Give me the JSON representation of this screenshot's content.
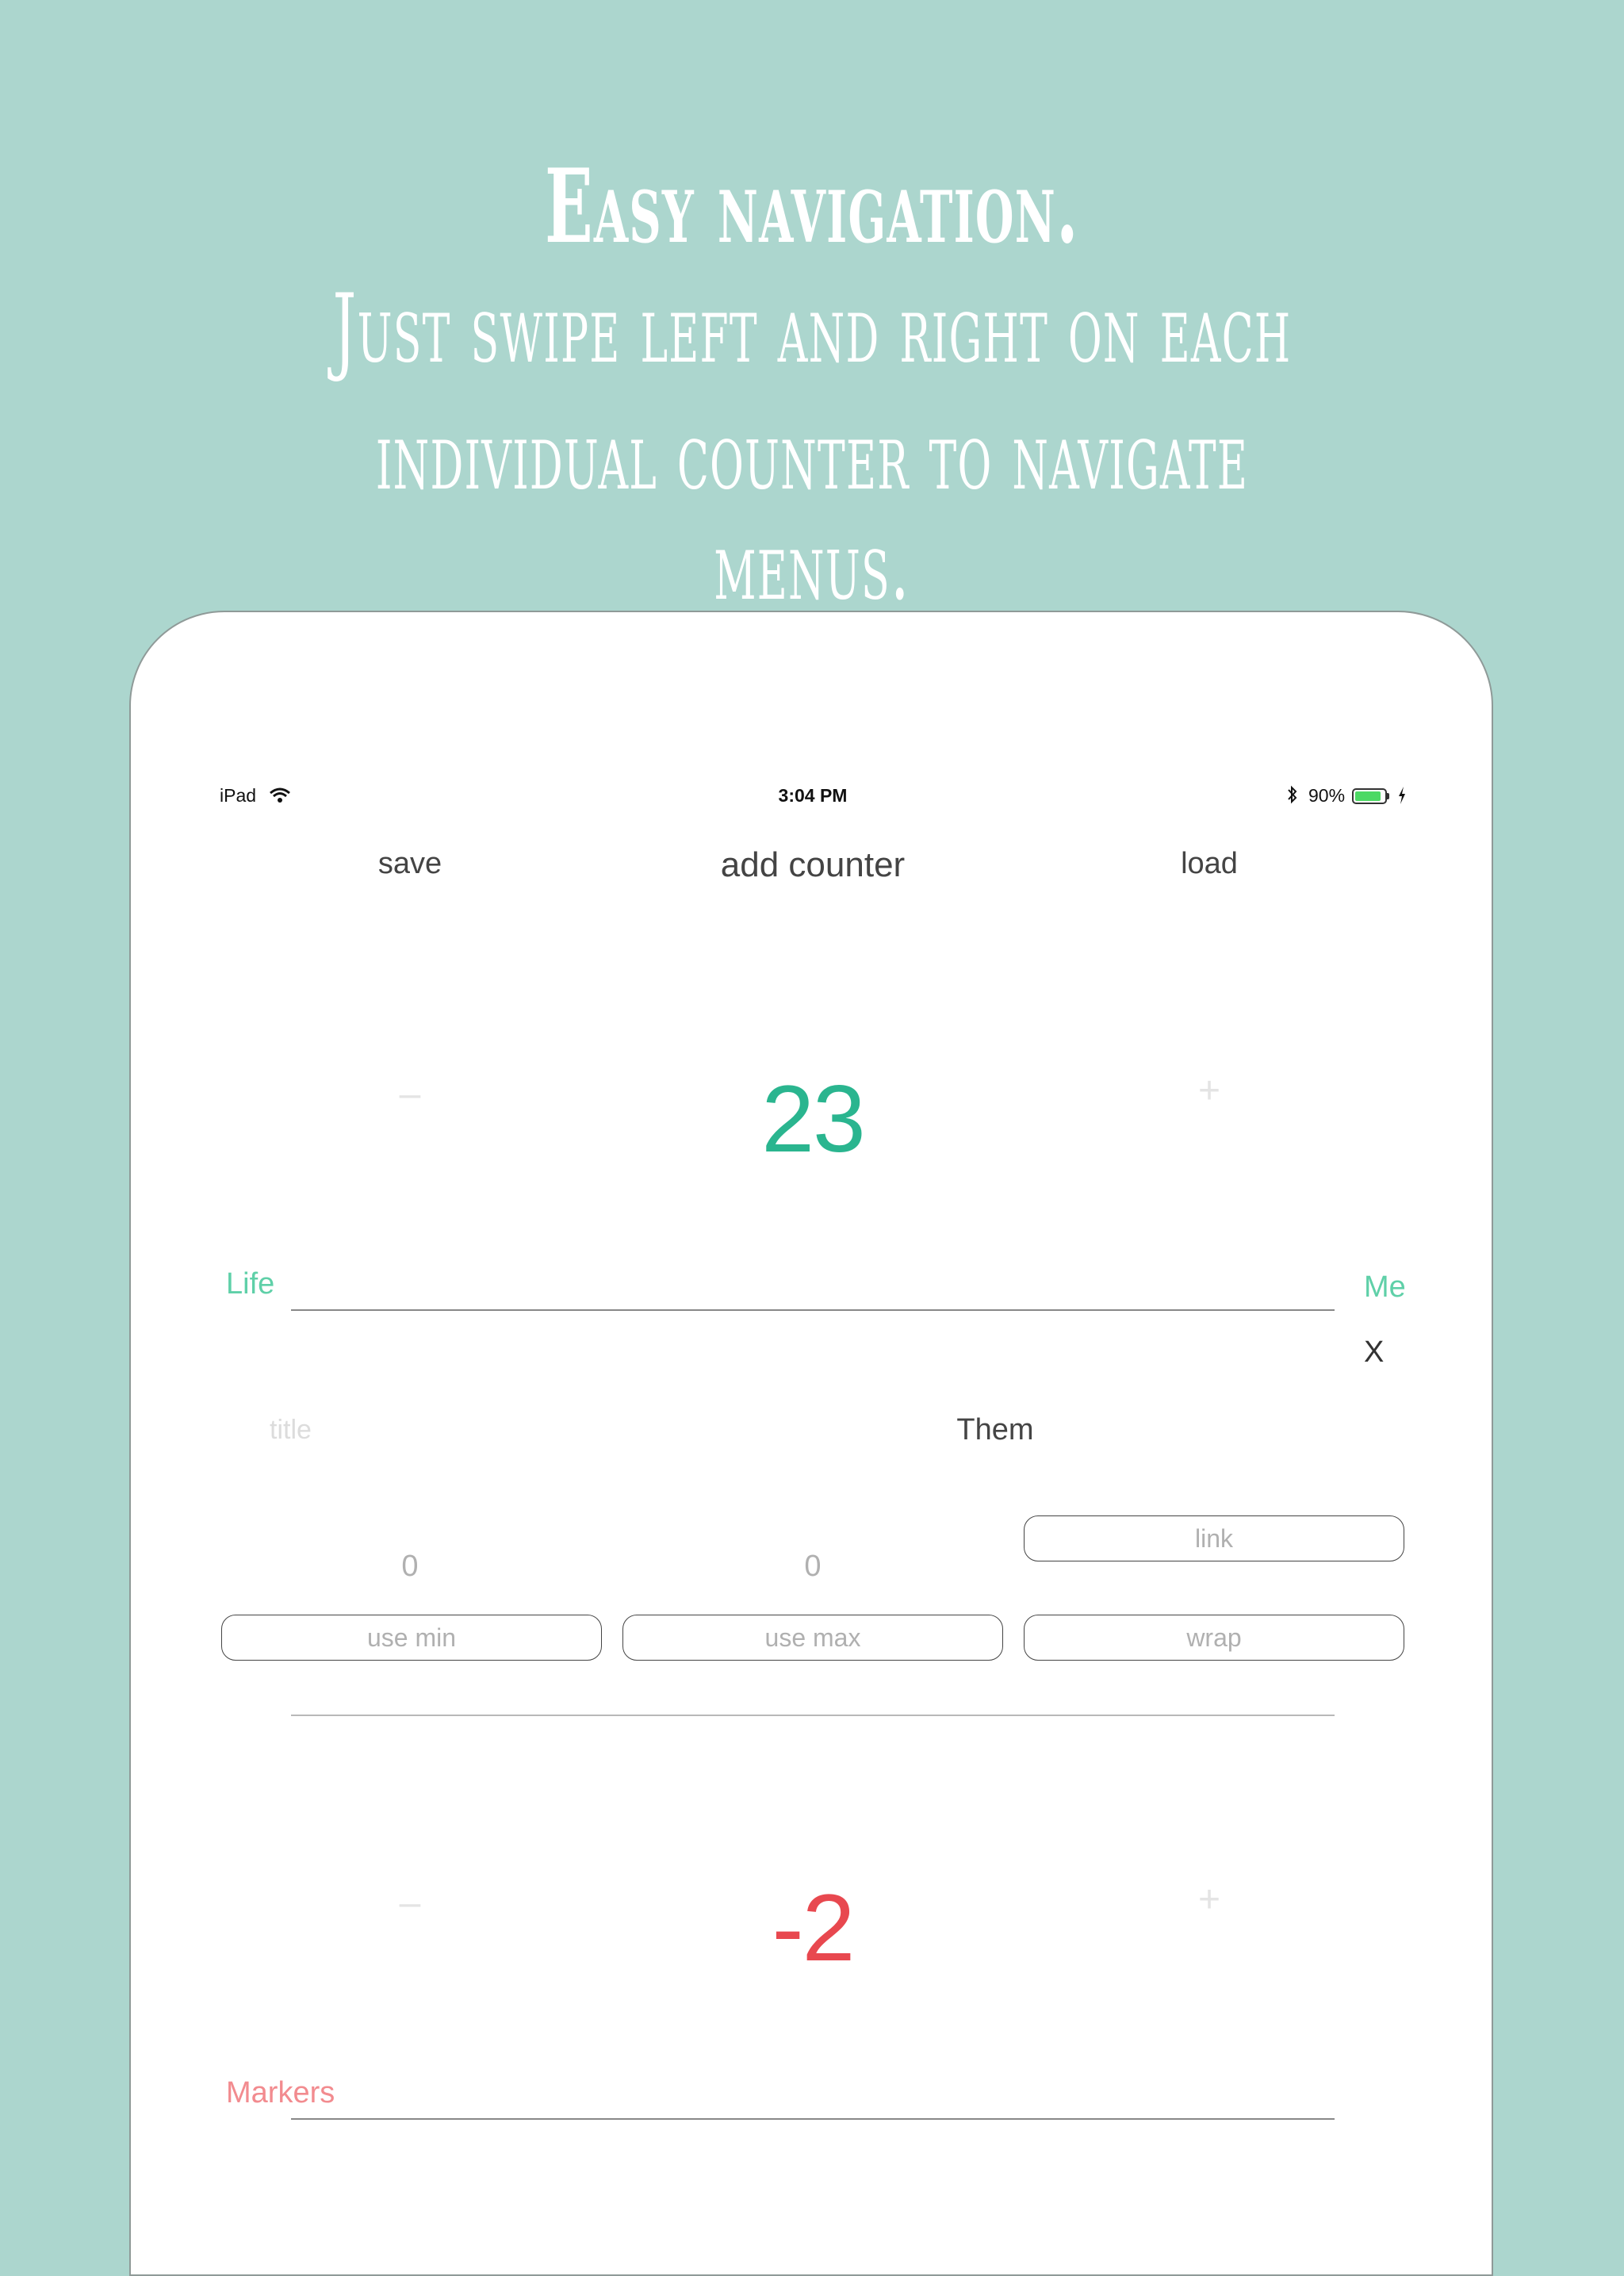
{
  "promo": {
    "line1": "Easy navigation.",
    "line2": "Just swipe left and right on each",
    "line3": "individual counter to navigate menus."
  },
  "status_bar": {
    "device": "iPad",
    "time": "3:04 PM",
    "battery": "90%",
    "battery_level": 0.9
  },
  "toolbar": {
    "save_label": "save",
    "add_counter_label": "add counter",
    "load_label": "load"
  },
  "counters": [
    {
      "value": "23",
      "minus": "–",
      "plus": "+",
      "name": "Life",
      "owner": "Me",
      "color": "#2ab58f",
      "name_color": "#5fd0a8",
      "edit": {
        "close": "X",
        "title_placeholder": "title",
        "owner_value": "Them",
        "min_value": "0",
        "max_value": "0",
        "link_label": "link",
        "use_min_label": "use min",
        "use_max_label": "use max",
        "wrap_label": "wrap"
      }
    },
    {
      "value": "-2",
      "minus": "–",
      "plus": "+",
      "name": "Markers",
      "color": "#e8484f",
      "name_color": "#f28b8f"
    }
  ]
}
